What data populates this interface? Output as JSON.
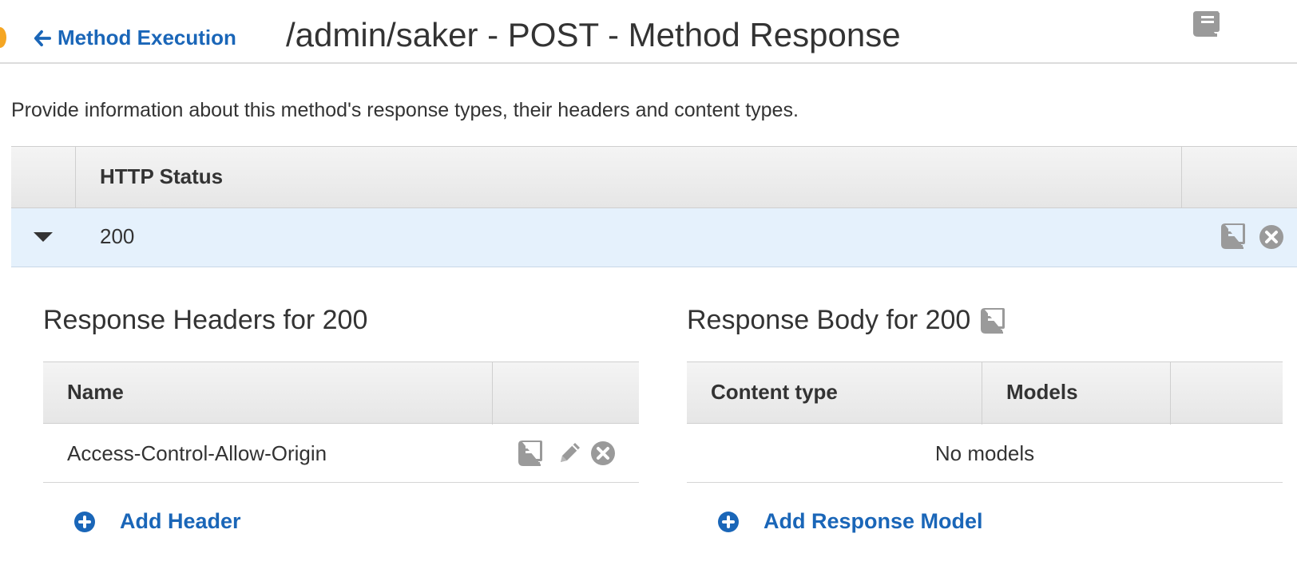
{
  "header": {
    "back_link": "Method Execution",
    "title": "/admin/saker - POST - Method Response"
  },
  "description": "Provide information about this method's response types, their headers and content types.",
  "status_table": {
    "column_header": "HTTP Status",
    "rows": [
      {
        "status": "200",
        "expanded": true
      }
    ]
  },
  "response_headers": {
    "title": "Response Headers for 200",
    "columns": [
      "Name"
    ],
    "rows": [
      {
        "name": "Access-Control-Allow-Origin"
      }
    ],
    "add_label": "Add Header"
  },
  "response_body": {
    "title": "Response Body for 200",
    "columns": [
      "Content type",
      "Models"
    ],
    "empty_text": "No models",
    "add_label": "Add Response Model"
  },
  "colors": {
    "link_blue": "#1a66b8",
    "icon_gray": "#9a9a9a",
    "selected_row_bg": "#e5f1fc",
    "orange_accent": "#f5a623"
  },
  "icons": [
    "arrow-left-icon",
    "book-icon",
    "close-circle-icon",
    "caret-down-icon",
    "pencil-icon",
    "plus-circle-icon"
  ]
}
